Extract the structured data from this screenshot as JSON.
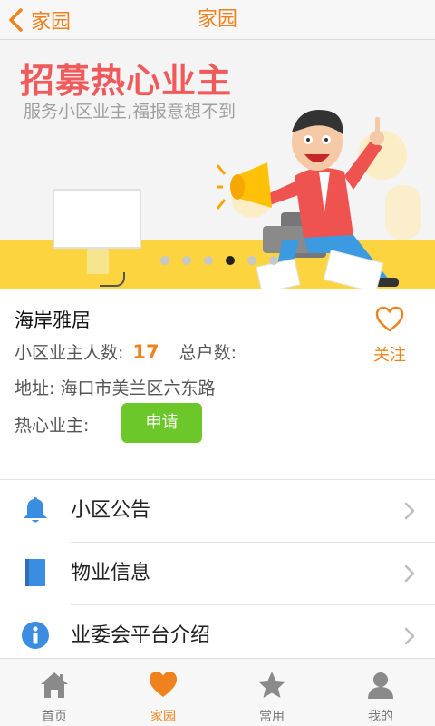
{
  "header": {
    "back_label": "家园",
    "title": "家园"
  },
  "banner": {
    "title": "招募热心业主",
    "subtitle": "服务小区业主,福报意想不到",
    "dot_count": 6,
    "active_dot_index": 3
  },
  "community": {
    "name": "海岸雅居",
    "owner_count_label": "小区业主人数:",
    "owner_count_value": "17",
    "households_label": "总户数:",
    "address": "地址: 海口市美兰区六东路",
    "volunteer_label": "热心业主:",
    "apply_label": "申请",
    "follow_label": "关注"
  },
  "menu": {
    "items": [
      {
        "label": "小区公告",
        "icon": "bell-icon"
      },
      {
        "label": "物业信息",
        "icon": "book-icon"
      },
      {
        "label": "业委会平台介绍",
        "icon": "info-icon"
      }
    ]
  },
  "tabbar": {
    "items": [
      {
        "label": "首页",
        "icon": "home-icon"
      },
      {
        "label": "家园",
        "icon": "heart-icon"
      },
      {
        "label": "常用",
        "icon": "star-icon"
      },
      {
        "label": "我的",
        "icon": "user-icon"
      }
    ],
    "active_index": 1
  },
  "colors": {
    "accent": "#f0821e",
    "apply_green": "#6cc72a",
    "banner_red": "#f05a5a",
    "icon_blue": "#3a8de0"
  }
}
